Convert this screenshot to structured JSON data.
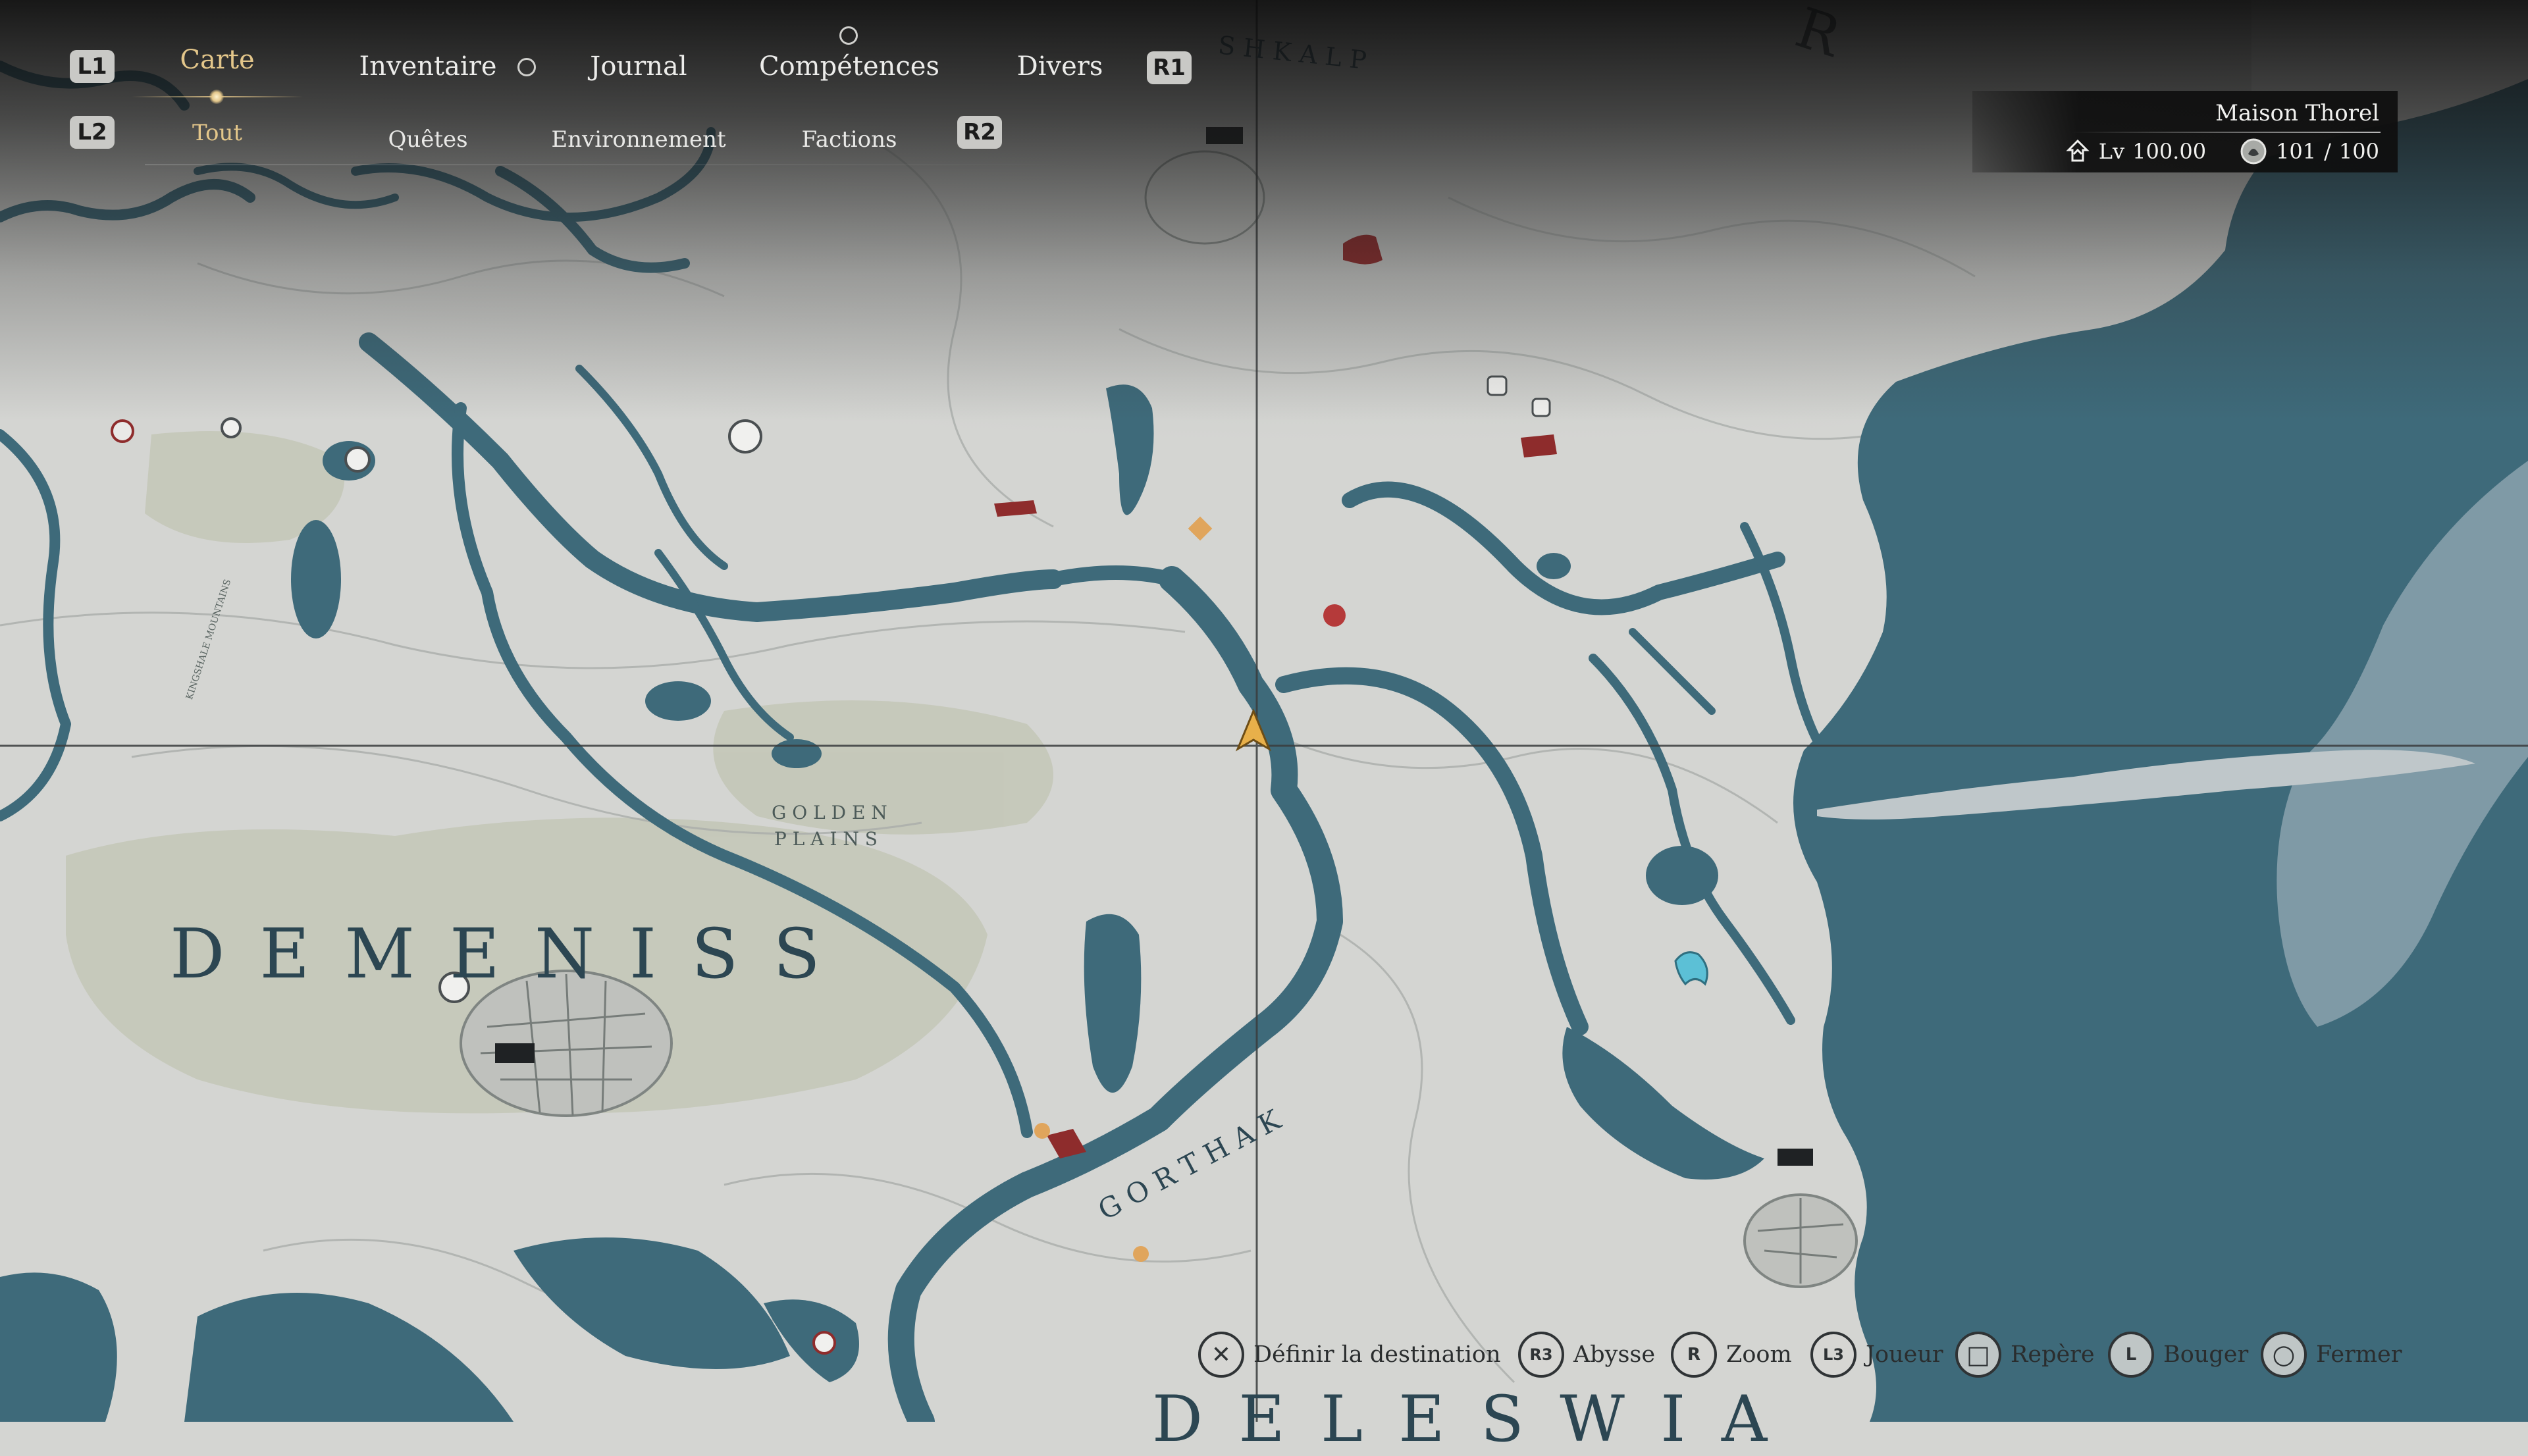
{
  "tabs": {
    "main": [
      {
        "label": "Carte",
        "active": true
      },
      {
        "label": "Inventaire",
        "active": false
      },
      {
        "label": "Journal",
        "active": false
      },
      {
        "label": "Compétences",
        "active": false
      },
      {
        "label": "Divers",
        "active": false
      }
    ],
    "sub": [
      {
        "label": "Tout",
        "active": true
      },
      {
        "label": "Quêtes",
        "active": false
      },
      {
        "label": "Environnement",
        "active": false
      },
      {
        "label": "Factions",
        "active": false
      }
    ],
    "buttons": {
      "l1": "L1",
      "r1": "R1",
      "l2": "L2",
      "r2": "R2"
    }
  },
  "player": {
    "name": "Maison Thorel",
    "level_label": "Lv",
    "level": "100.00",
    "count_current": "101",
    "count_separator": "/",
    "count_max": "100"
  },
  "map_labels": {
    "demeniss": "D E M E N I S S",
    "golden_1": "G O L D E N",
    "golden_2": "P L A I N S",
    "gorthak": "G O R T H A K",
    "kingshale": "KINGSHALE MOUNTAINS",
    "top_region": "S H K A L P",
    "bottom_region": "D E L E S W I A",
    "top_right_rune": "R"
  },
  "controls": [
    {
      "button": "✕",
      "label": "Définir la destination"
    },
    {
      "button": "R3",
      "label": "Abysse"
    },
    {
      "button": "R",
      "label": "Zoom"
    },
    {
      "button": "L3",
      "label": "Joueur"
    },
    {
      "button": "□",
      "label": "Repère"
    },
    {
      "button": "L",
      "label": "Bouger"
    },
    {
      "button": "○",
      "label": "Fermer"
    }
  ],
  "colors": {
    "water": "#3e6a7a",
    "land": "#d4d5d2",
    "accent": "#e3c68a",
    "marker_red": "#8e2c2c",
    "player_arrow": "#e8b04a"
  },
  "icons": [
    "player-arrow-icon",
    "faction-settlement-icon",
    "quest-marker-icon",
    "shrine-icon",
    "mount-icon"
  ]
}
